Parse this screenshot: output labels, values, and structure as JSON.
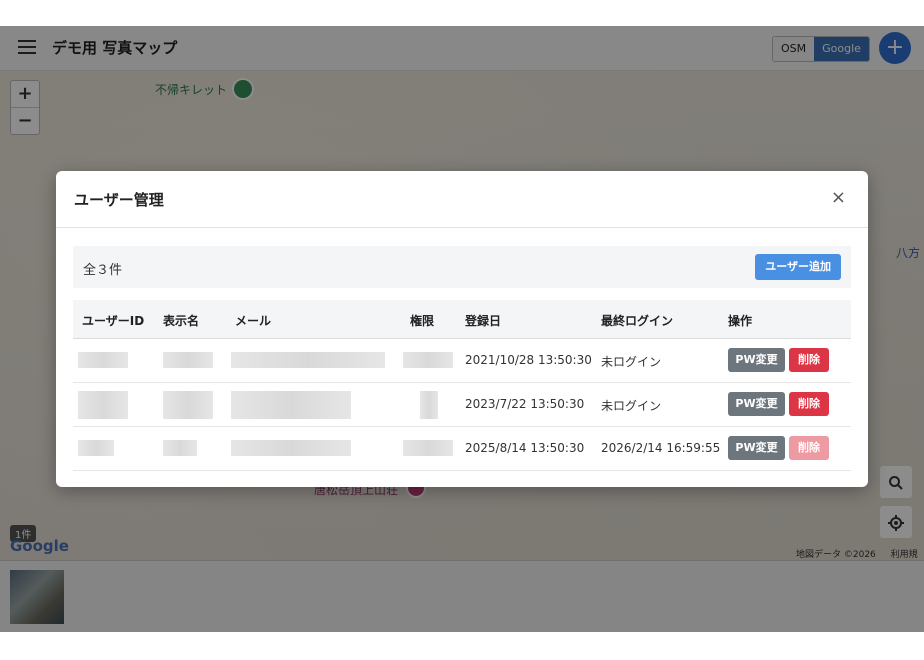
{
  "app": {
    "title": "デモ用 写真マップ",
    "map_toggle": {
      "osm": "OSM",
      "google": "Google",
      "selected": "Google"
    },
    "add_button": "+"
  },
  "map": {
    "zoom_in": "+",
    "zoom_out": "−",
    "poi_label": "不帰キレット",
    "side_label": "八方",
    "bottom_label": "唐松岳頂上山荘",
    "count_badge": "1件",
    "logo": "Google",
    "attribution": {
      "data": "地図データ ©2026",
      "terms": "利用規約"
    }
  },
  "modal": {
    "title": "ユーザー管理",
    "close": "×",
    "total": "全３件",
    "add_user": "ユーザー追加",
    "columns": [
      "ユーザーID",
      "表示名",
      "メール",
      "権限",
      "登録日",
      "最終ログイン",
      "操作"
    ],
    "rows": [
      {
        "registered": "2021/10/28 13:50:30",
        "last_login": "未ログイン",
        "pw": "PW変更",
        "delete": "削除",
        "delete_disabled": false
      },
      {
        "registered": "2023/7/22 13:50:30",
        "last_login": "未ログイン",
        "pw": "PW変更",
        "delete": "削除",
        "delete_disabled": false
      },
      {
        "registered": "2025/8/14 13:50:30",
        "last_login": "2026/2/14 16:59:55",
        "pw": "PW変更",
        "delete": "削除",
        "delete_disabled": true
      }
    ]
  },
  "colors": {
    "accent": "#4a90e2",
    "danger": "#dc3545",
    "secondary": "#6d757d",
    "brand": "#2f6fd0"
  },
  "icons": [
    "menu-icon",
    "plus-icon",
    "close-icon",
    "search-icon",
    "locate-icon",
    "poi-icon"
  ]
}
